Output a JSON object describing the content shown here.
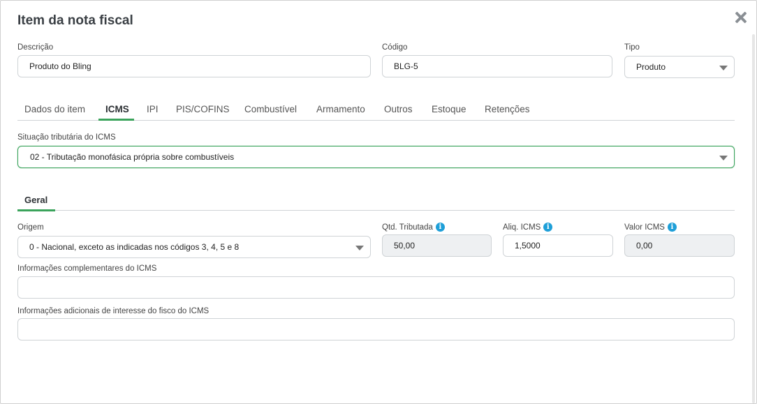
{
  "modal": {
    "title": "Item da nota fiscal"
  },
  "descricao": {
    "label": "Descrição",
    "value": "Produto do Bling"
  },
  "codigo": {
    "label": "Código",
    "value": "BLG-5"
  },
  "tipo": {
    "label": "Tipo",
    "value": "Produto"
  },
  "tabs": [
    {
      "label": "Dados do item",
      "active": false
    },
    {
      "label": "ICMS",
      "active": true
    },
    {
      "label": "IPI",
      "active": false
    },
    {
      "label": "PIS/COFINS",
      "active": false
    },
    {
      "label": "Combustível",
      "active": false
    },
    {
      "label": "Armamento",
      "active": false
    },
    {
      "label": "Outros",
      "active": false
    },
    {
      "label": "Estoque",
      "active": false
    },
    {
      "label": "Retenções",
      "active": false
    }
  ],
  "situacao": {
    "label": "Situação tributária do ICMS",
    "value": "02 - Tributação monofásica própria sobre combustíveis"
  },
  "subtab": {
    "label": "Geral"
  },
  "origem": {
    "label": "Origem",
    "value": "0 - Nacional, exceto as indicadas nos códigos 3, 4, 5 e 8"
  },
  "qtd_tributada": {
    "label": "Qtd. Tributada",
    "value": "50,00"
  },
  "aliq_icms": {
    "label": "Aliq. ICMS",
    "value": "1,5000"
  },
  "valor_icms": {
    "label": "Valor ICMS",
    "value": "0,00"
  },
  "info_complementares": {
    "label": "Informações complementares do ICMS",
    "value": ""
  },
  "info_adicionais": {
    "label": "Informações adicionais de interesse do fisco do ICMS",
    "value": ""
  },
  "colors": {
    "accent": "#3aa35b",
    "info": "#1e9fd8"
  },
  "icons": {
    "close": "close-icon",
    "info": "info-icon",
    "dropdown": "chevron-down-icon"
  }
}
